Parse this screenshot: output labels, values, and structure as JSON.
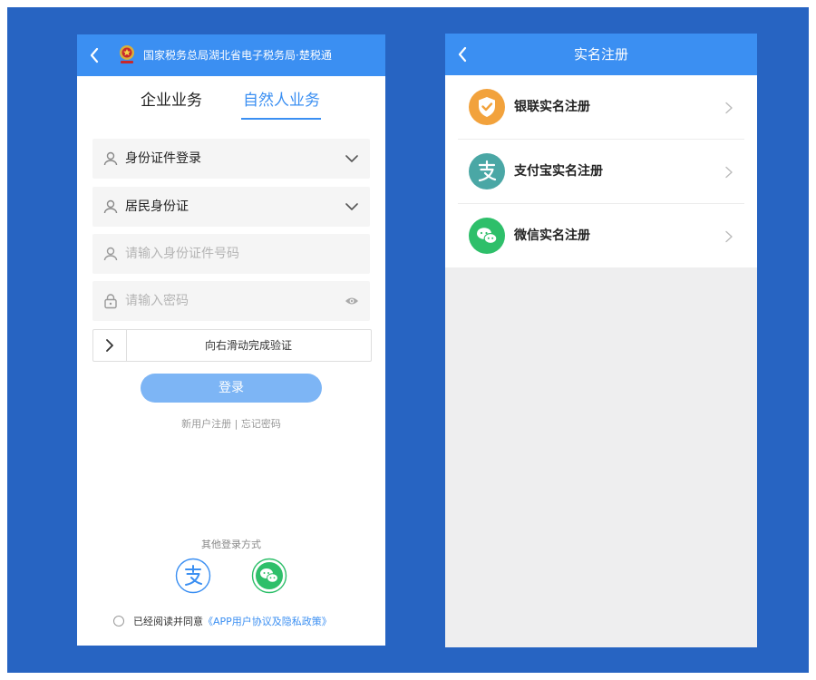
{
  "left_screen": {
    "header_title": "国家税务总局湖北省电子税务局·楚税通",
    "tabs": [
      {
        "label": "企业业务",
        "active": false
      },
      {
        "label": "自然人业务",
        "active": true
      }
    ],
    "login_type": "身份证件登录",
    "id_type": "居民身份证",
    "id_number_placeholder": "请输入身份证件号码",
    "password_placeholder": "请输入密码",
    "slider_text": "向右滑动完成验证",
    "login_button": "登录",
    "register_link": "新用户注册",
    "link_separator": "|",
    "forgot_link": "忘记密码",
    "other_login_label": "其他登录方式",
    "agreement_prefix": "已经阅读并同意",
    "agreement_link": "《APP用户协议及隐私政策》",
    "icons": {
      "back": "chevron-left-icon",
      "emblem": "tax-emblem-icon",
      "user": "user-icon",
      "lock": "lock-icon",
      "eye": "eye-icon",
      "dropdown": "chevron-down-icon",
      "slider": "chevron-right-icon",
      "alipay": "alipay-icon",
      "wechat": "wechat-icon"
    }
  },
  "right_screen": {
    "title": "实名注册",
    "items": [
      {
        "label": "银联实名注册",
        "icon": "unionpay-shield-icon",
        "color": "#f2a23c"
      },
      {
        "label": "支付宝实名注册",
        "icon": "alipay-icon",
        "color": "#4aa7a5"
      },
      {
        "label": "微信实名注册",
        "icon": "wechat-icon",
        "color": "#2ebf6a"
      }
    ]
  },
  "colors": {
    "background": "#2764c2",
    "accent": "#3b8ff2",
    "button": "#7db5f5"
  }
}
